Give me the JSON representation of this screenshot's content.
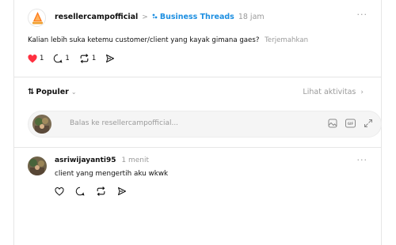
{
  "post": {
    "username": "resellercampofficial",
    "breadcrumb_sep": ">",
    "topic": "Business Threads",
    "time": "18 jam",
    "more": "···",
    "text": "Kalian lebih suka ketemu customer/client yang kayak gimana gaes?",
    "translate": "Terjemahkan",
    "likes": "1",
    "comments": "1",
    "reposts": "1",
    "like_color": "#ff3040",
    "topic_color": "#1d8fe1"
  },
  "sortbar": {
    "sort_label": "Populer",
    "activity_label": "Lihat aktivitas"
  },
  "reply": {
    "placeholder": "Balas ke resellercampofficial...",
    "gif_label": "GIF"
  },
  "comment": {
    "username": "asriwijayanti95",
    "time": "1 menit",
    "more": "···",
    "text": "client yang mengertih aku wkwk"
  },
  "icons": {
    "like": "heart-icon",
    "comment": "comment-icon",
    "repost": "repost-icon",
    "share": "share-icon",
    "sort": "sort-arrows-icon",
    "image": "image-icon",
    "gif": "gif-icon",
    "expand": "expand-icon"
  }
}
